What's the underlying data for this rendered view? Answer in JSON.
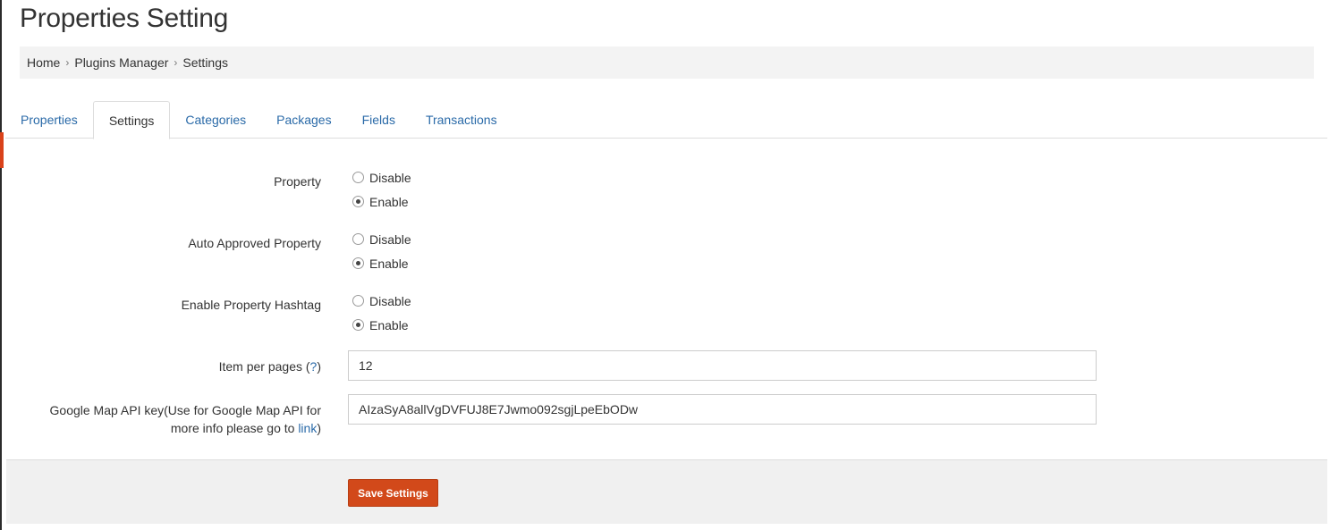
{
  "page": {
    "title": "Properties Setting"
  },
  "breadcrumb": {
    "items": [
      "Home",
      "Plugins Manager",
      "Settings"
    ],
    "separator": "›"
  },
  "tabs": [
    {
      "label": "Properties",
      "active": false
    },
    {
      "label": "Settings",
      "active": true
    },
    {
      "label": "Categories",
      "active": false
    },
    {
      "label": "Packages",
      "active": false
    },
    {
      "label": "Fields",
      "active": false
    },
    {
      "label": "Transactions",
      "active": false
    }
  ],
  "settings": {
    "property": {
      "label": "Property",
      "options": [
        "Disable",
        "Enable"
      ],
      "selected": "Enable"
    },
    "auto_approved": {
      "label": "Auto Approved Property",
      "options": [
        "Disable",
        "Enable"
      ],
      "selected": "Enable"
    },
    "hashtag": {
      "label": "Enable Property Hashtag",
      "options": [
        "Disable",
        "Enable"
      ],
      "selected": "Enable"
    },
    "items_per_page": {
      "label_prefix": "Item per pages (",
      "help": "?",
      "label_suffix": ")",
      "value": "12"
    },
    "google_map_key": {
      "label_line1": "Google Map API key(Use for Google Map API for",
      "label_line2_prefix": "more info please go to ",
      "link_text": "link",
      "label_line2_suffix": ")",
      "value": "AIzaSyA8allVgDVFUJ8E7Jwmo092sgjLpeEbODw"
    }
  },
  "footer": {
    "save_label": "Save Settings"
  },
  "colors": {
    "accent": "#d2491a",
    "link": "#2a6aa8",
    "breadcrumb_bg": "#f3f3f3",
    "footer_bg": "#f0f0f0"
  }
}
